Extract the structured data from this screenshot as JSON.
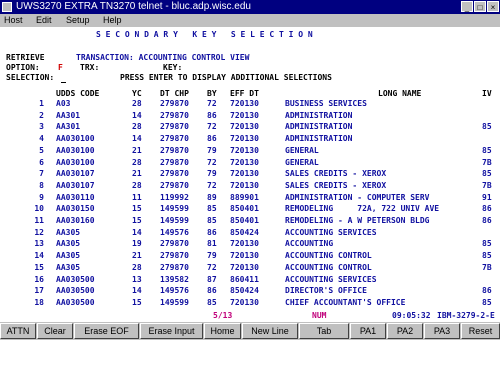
{
  "window": {
    "title": "UWS3270 EXTRA TN3270 telnet - bluc.adp.wisc.edu"
  },
  "menu": [
    "Host",
    "Edit",
    "Setup",
    "Help"
  ],
  "screen": {
    "header": "S E C O N D A R Y   K E Y   S E L E C T I O N",
    "retrieve": "RETRIEVE",
    "transaction": "TRANSACTION: ACCOUNTING CONTROL VIEW",
    "option_label": "OPTION:",
    "option_value": "F",
    "trx_label": "TRX:",
    "key_label": "KEY:",
    "selection_label": "SELECTION:",
    "instruction": "PRESS ENTER TO DISPLAY ADDITIONAL SELECTIONS",
    "columns": {
      "udds": "UDDS CODE",
      "yc": "YC",
      "dtchp": "DT CHP",
      "by": "BY",
      "effdt": "EFF DT",
      "longname": "LONG NAME",
      "iv": "IV"
    },
    "rows": [
      {
        "n": "1",
        "udds": "A03",
        "yc": "28",
        "dt": "279870",
        "by": "72",
        "eff": "720130",
        "name": "BUSINESS SERVICES",
        "iv": ""
      },
      {
        "n": "2",
        "udds": "AA301",
        "yc": "14",
        "dt": "279870",
        "by": "86",
        "eff": "720130",
        "name": "ADMINISTRATION",
        "iv": ""
      },
      {
        "n": "3",
        "udds": "AA301",
        "yc": "28",
        "dt": "279870",
        "by": "72",
        "eff": "720130",
        "name": "ADMINISTRATION",
        "iv": "85"
      },
      {
        "n": "4",
        "udds": "AA030100",
        "yc": "14",
        "dt": "279870",
        "by": "86",
        "eff": "720130",
        "name": "ADMINISTRATION",
        "iv": ""
      },
      {
        "n": "5",
        "udds": "AA030100",
        "yc": "21",
        "dt": "279870",
        "by": "79",
        "eff": "720130",
        "name": "GENERAL",
        "iv": "85"
      },
      {
        "n": "6",
        "udds": "AA030100",
        "yc": "28",
        "dt": "279870",
        "by": "72",
        "eff": "720130",
        "name": "GENERAL",
        "iv": "7B"
      },
      {
        "n": "7",
        "udds": "AA030107",
        "yc": "21",
        "dt": "279870",
        "by": "79",
        "eff": "720130",
        "name": "SALES CREDITS - XEROX",
        "iv": "85"
      },
      {
        "n": "8",
        "udds": "AA030107",
        "yc": "28",
        "dt": "279870",
        "by": "72",
        "eff": "720130",
        "name": "SALES CREDITS - XEROX",
        "iv": "7B"
      },
      {
        "n": "9",
        "udds": "AA030110",
        "yc": "11",
        "dt": "119992",
        "by": "89",
        "eff": "889901",
        "name": "ADMINISTRATION - COMPUTER SERV",
        "iv": "91"
      },
      {
        "n": "10",
        "udds": "AA030150",
        "yc": "15",
        "dt": "149599",
        "by": "85",
        "eff": "850401",
        "name": "REMODELING     72A, 722 UNIV AVE",
        "iv": "86"
      },
      {
        "n": "11",
        "udds": "AA030160",
        "yc": "15",
        "dt": "149599",
        "by": "85",
        "eff": "850401",
        "name": "REMODELING - A W PETERSON BLDG",
        "iv": "86"
      },
      {
        "n": "12",
        "udds": "AA305",
        "yc": "14",
        "dt": "149576",
        "by": "86",
        "eff": "850424",
        "name": "ACCOUNTING SERVICES",
        "iv": ""
      },
      {
        "n": "13",
        "udds": "AA305",
        "yc": "19",
        "dt": "279870",
        "by": "81",
        "eff": "720130",
        "name": "ACCOUNTING",
        "iv": "85"
      },
      {
        "n": "14",
        "udds": "AA305",
        "yc": "21",
        "dt": "279870",
        "by": "79",
        "eff": "720130",
        "name": "ACCOUNTING CONTROL",
        "iv": "85"
      },
      {
        "n": "15",
        "udds": "AA305",
        "yc": "28",
        "dt": "279870",
        "by": "72",
        "eff": "720130",
        "name": "ACCOUNTING CONTROL",
        "iv": "7B"
      },
      {
        "n": "16",
        "udds": "AA030500",
        "yc": "13",
        "dt": "139582",
        "by": "87",
        "eff": "860411",
        "name": "ACCOUNTING SERVICES",
        "iv": ""
      },
      {
        "n": "17",
        "udds": "AA030500",
        "yc": "14",
        "dt": "149576",
        "by": "86",
        "eff": "850424",
        "name": "DIRECTOR'S OFFICE",
        "iv": "86"
      },
      {
        "n": "18",
        "udds": "AA030500",
        "yc": "15",
        "dt": "149599",
        "by": "85",
        "eff": "720130",
        "name": "CHIEF ACCOUNTANT'S OFFICE",
        "iv": "85"
      }
    ],
    "status": {
      "page": "5/13",
      "mode": "NUM",
      "time": "09:05:32",
      "model": "IBM-3279-2-E"
    }
  },
  "keys": [
    "ATTN",
    "Clear",
    "Erase EOF",
    "Erase Input",
    "Home",
    "New Line",
    "Tab",
    "PA1",
    "PA2",
    "PA3",
    "Reset"
  ]
}
